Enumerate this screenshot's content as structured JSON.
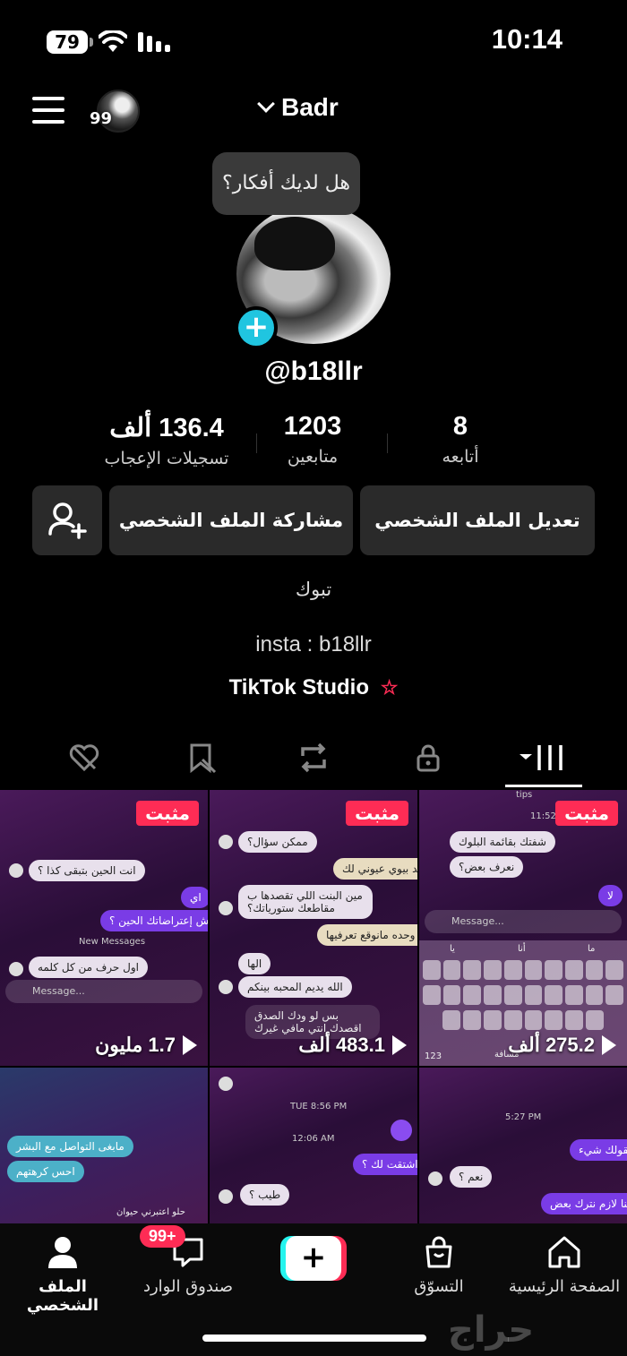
{
  "status_bar": {
    "battery": "79",
    "time": "10:14"
  },
  "header": {
    "username": "Badr",
    "notif_count": "99"
  },
  "profile": {
    "prompt_bubble": "هل لديك أفكار؟",
    "handle": "@b18llr",
    "stats": [
      {
        "value": "136.4 ألف",
        "label": "تسجيلات الإعجاب"
      },
      {
        "value": "1203",
        "label": "متابعين"
      },
      {
        "value": "8",
        "label": "أتابعه"
      }
    ],
    "buttons": {
      "edit": "تعديل الملف الشخصي",
      "share": "مشاركة الملف الشخصي"
    },
    "bio": {
      "city": "تبوك",
      "insta": "insta : b18llr"
    },
    "studio": "TikTok Studio"
  },
  "tabs": [
    {
      "icon": "videos-grid-icon",
      "active": true
    },
    {
      "icon": "lock-icon",
      "active": false
    },
    {
      "icon": "repost-icon",
      "active": false
    },
    {
      "icon": "bookmark-icon",
      "active": false
    },
    {
      "icon": "liked-icon",
      "active": false
    }
  ],
  "videos": [
    {
      "pinned": "مثبت",
      "views": "275.2 ألف"
    },
    {
      "pinned": "مثبت",
      "views": "483.1 ألف"
    },
    {
      "pinned": "مثبت",
      "views": "1.7 مليون"
    }
  ],
  "video_content": {
    "v1": {
      "tips": "tips",
      "time": "11:52 PM",
      "m1": "شفتك بقائمة البلوك",
      "m2": "نعرف بعض؟",
      "m3": "لا",
      "input": "Message...",
      "keys": [
        "ما",
        "أنا",
        "يا"
      ],
      "space": "مسافة",
      "num": "123"
    },
    "v2": {
      "m1": "ممكن سؤال؟",
      "m2": "اكيد بيوي عيوني لك",
      "m3": "مين البنت اللي تقصدها ب مقاطعك ستورياتك؟",
      "m4": "ابد وحده مانوقع تعرفيها",
      "m5": "الها",
      "m6": "الله يديم المحبه بينكم",
      "m7": "بس لو ودك الصدق اقصدك انتي مافي غيرك"
    },
    "v3": {
      "m1": "انت الحين بتبقى كذا ؟",
      "m2": "اي",
      "m3": "وش إعتراضاتك الحين ؟",
      "new_messages": "New Messages",
      "m4": "اول حرف من كل كلمه",
      "input": "Message..."
    },
    "v4": {
      "time": "TUE 8:56 PM",
      "time2": "12:06 AM",
      "m1": "اشتقت لك ؟",
      "m2": "طيب ؟"
    },
    "v5": {
      "m1": "مابغى التواصل مع البشر",
      "m2": "احس كرهتهم",
      "m3": "حلو اعتبرني حيوان"
    },
    "v6": {
      "time": "5:27 PM",
      "m1": "يقولك شيء",
      "m2": "نعم ؟",
      "m3": "احنا لازم نترك بعض"
    }
  },
  "nav": {
    "home": "الصفحة الرئيسية",
    "shop": "التسوّق",
    "create": "+",
    "inbox": "صندوق الوارد",
    "inbox_badge": "99+",
    "profile": "الملف الشخصي"
  },
  "watermark": "حراج",
  "colors": {
    "accent": "#fe2c55",
    "cyan": "#25f4ee",
    "add_badge": "#20c5e0"
  }
}
